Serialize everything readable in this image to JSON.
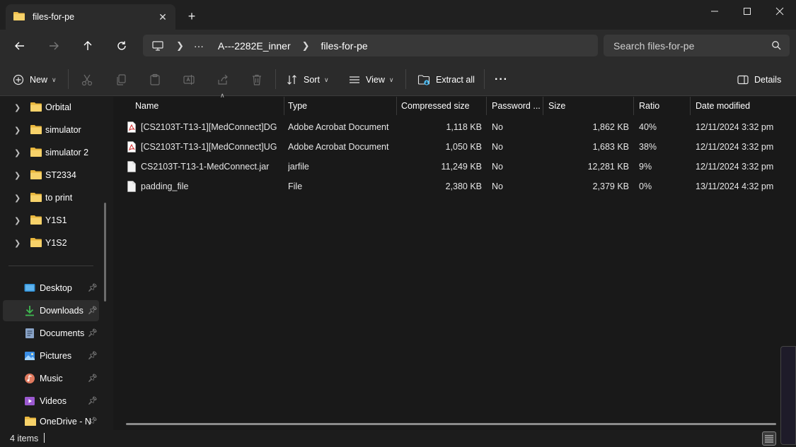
{
  "window": {
    "tab_title": "files-for-pe",
    "tab_close_glyph": "✕",
    "new_tab_glyph": "+"
  },
  "address_bar": {
    "more_glyph": "···",
    "breadcrumbs": [
      "A---2282E_inner",
      "files-for-pe"
    ],
    "search_placeholder": "Search files-for-pe"
  },
  "toolbar": {
    "new_label": "New",
    "sort_label": "Sort",
    "view_label": "View",
    "extract_label": "Extract all",
    "more_glyph": "···",
    "details_label": "Details"
  },
  "sidebar": {
    "tree_items": [
      "Orbital",
      "simulator",
      "simulator 2",
      "ST2334",
      "to print",
      "Y1S1",
      "Y1S2"
    ],
    "quick_access": [
      {
        "label": "Desktop",
        "icon": "desktop-icon"
      },
      {
        "label": "Downloads",
        "icon": "downloads-icon"
      },
      {
        "label": "Documents",
        "icon": "documents-icon"
      },
      {
        "label": "Pictures",
        "icon": "pictures-icon"
      },
      {
        "label": "Music",
        "icon": "music-icon"
      },
      {
        "label": "Videos",
        "icon": "videos-icon"
      },
      {
        "label": "OneDrive - N",
        "icon": "onedrive-folder-icon"
      }
    ]
  },
  "table": {
    "columns": [
      "Name",
      "Type",
      "Compressed size",
      "Password ...",
      "Size",
      "Ratio",
      "Date modified"
    ],
    "rows": [
      {
        "name": "[CS2103T-T13-1][MedConnect]DG",
        "type": "Adobe Acrobat Document",
        "compressed": "1,118 KB",
        "password": "No",
        "size": "1,862 KB",
        "ratio": "40%",
        "date": "12/11/2024 3:32 pm",
        "icon": "pdf-icon"
      },
      {
        "name": "[CS2103T-T13-1][MedConnect]UG",
        "type": "Adobe Acrobat Document",
        "compressed": "1,050 KB",
        "password": "No",
        "size": "1,683 KB",
        "ratio": "38%",
        "date": "12/11/2024 3:32 pm",
        "icon": "pdf-icon"
      },
      {
        "name": "CS2103T-T13-1-MedConnect.jar",
        "type": "jarfile",
        "compressed": "11,249 KB",
        "password": "No",
        "size": "12,281 KB",
        "ratio": "9%",
        "date": "12/11/2024 3:32 pm",
        "icon": "file-icon"
      },
      {
        "name": "padding_file",
        "type": "File",
        "compressed": "2,380 KB",
        "password": "No",
        "size": "2,379 KB",
        "ratio": "0%",
        "date": "13/11/2024 4:32 pm",
        "icon": "file-icon"
      }
    ]
  },
  "status": {
    "item_count": "4 items"
  },
  "colors": {
    "folder": "#f2c14e",
    "accent": "#4cc2ff",
    "pdf_red": "#d32f2f"
  }
}
